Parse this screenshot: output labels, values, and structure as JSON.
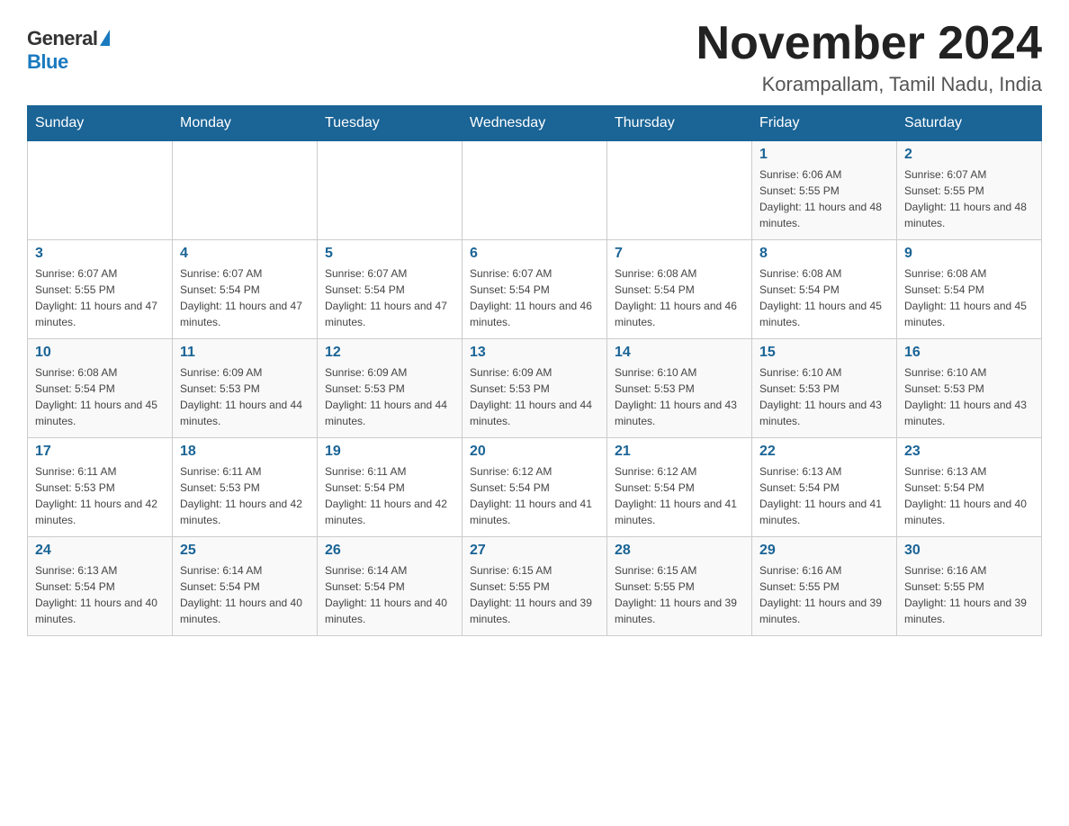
{
  "logo": {
    "general": "General",
    "blue": "Blue"
  },
  "title": "November 2024",
  "location": "Korampallam, Tamil Nadu, India",
  "days_of_week": [
    "Sunday",
    "Monday",
    "Tuesday",
    "Wednesday",
    "Thursday",
    "Friday",
    "Saturday"
  ],
  "weeks": [
    [
      {
        "day": "",
        "sunrise": "",
        "sunset": "",
        "daylight": ""
      },
      {
        "day": "",
        "sunrise": "",
        "sunset": "",
        "daylight": ""
      },
      {
        "day": "",
        "sunrise": "",
        "sunset": "",
        "daylight": ""
      },
      {
        "day": "",
        "sunrise": "",
        "sunset": "",
        "daylight": ""
      },
      {
        "day": "",
        "sunrise": "",
        "sunset": "",
        "daylight": ""
      },
      {
        "day": "1",
        "sunrise": "Sunrise: 6:06 AM",
        "sunset": "Sunset: 5:55 PM",
        "daylight": "Daylight: 11 hours and 48 minutes."
      },
      {
        "day": "2",
        "sunrise": "Sunrise: 6:07 AM",
        "sunset": "Sunset: 5:55 PM",
        "daylight": "Daylight: 11 hours and 48 minutes."
      }
    ],
    [
      {
        "day": "3",
        "sunrise": "Sunrise: 6:07 AM",
        "sunset": "Sunset: 5:55 PM",
        "daylight": "Daylight: 11 hours and 47 minutes."
      },
      {
        "day": "4",
        "sunrise": "Sunrise: 6:07 AM",
        "sunset": "Sunset: 5:54 PM",
        "daylight": "Daylight: 11 hours and 47 minutes."
      },
      {
        "day": "5",
        "sunrise": "Sunrise: 6:07 AM",
        "sunset": "Sunset: 5:54 PM",
        "daylight": "Daylight: 11 hours and 47 minutes."
      },
      {
        "day": "6",
        "sunrise": "Sunrise: 6:07 AM",
        "sunset": "Sunset: 5:54 PM",
        "daylight": "Daylight: 11 hours and 46 minutes."
      },
      {
        "day": "7",
        "sunrise": "Sunrise: 6:08 AM",
        "sunset": "Sunset: 5:54 PM",
        "daylight": "Daylight: 11 hours and 46 minutes."
      },
      {
        "day": "8",
        "sunrise": "Sunrise: 6:08 AM",
        "sunset": "Sunset: 5:54 PM",
        "daylight": "Daylight: 11 hours and 45 minutes."
      },
      {
        "day": "9",
        "sunrise": "Sunrise: 6:08 AM",
        "sunset": "Sunset: 5:54 PM",
        "daylight": "Daylight: 11 hours and 45 minutes."
      }
    ],
    [
      {
        "day": "10",
        "sunrise": "Sunrise: 6:08 AM",
        "sunset": "Sunset: 5:54 PM",
        "daylight": "Daylight: 11 hours and 45 minutes."
      },
      {
        "day": "11",
        "sunrise": "Sunrise: 6:09 AM",
        "sunset": "Sunset: 5:53 PM",
        "daylight": "Daylight: 11 hours and 44 minutes."
      },
      {
        "day": "12",
        "sunrise": "Sunrise: 6:09 AM",
        "sunset": "Sunset: 5:53 PM",
        "daylight": "Daylight: 11 hours and 44 minutes."
      },
      {
        "day": "13",
        "sunrise": "Sunrise: 6:09 AM",
        "sunset": "Sunset: 5:53 PM",
        "daylight": "Daylight: 11 hours and 44 minutes."
      },
      {
        "day": "14",
        "sunrise": "Sunrise: 6:10 AM",
        "sunset": "Sunset: 5:53 PM",
        "daylight": "Daylight: 11 hours and 43 minutes."
      },
      {
        "day": "15",
        "sunrise": "Sunrise: 6:10 AM",
        "sunset": "Sunset: 5:53 PM",
        "daylight": "Daylight: 11 hours and 43 minutes."
      },
      {
        "day": "16",
        "sunrise": "Sunrise: 6:10 AM",
        "sunset": "Sunset: 5:53 PM",
        "daylight": "Daylight: 11 hours and 43 minutes."
      }
    ],
    [
      {
        "day": "17",
        "sunrise": "Sunrise: 6:11 AM",
        "sunset": "Sunset: 5:53 PM",
        "daylight": "Daylight: 11 hours and 42 minutes."
      },
      {
        "day": "18",
        "sunrise": "Sunrise: 6:11 AM",
        "sunset": "Sunset: 5:53 PM",
        "daylight": "Daylight: 11 hours and 42 minutes."
      },
      {
        "day": "19",
        "sunrise": "Sunrise: 6:11 AM",
        "sunset": "Sunset: 5:54 PM",
        "daylight": "Daylight: 11 hours and 42 minutes."
      },
      {
        "day": "20",
        "sunrise": "Sunrise: 6:12 AM",
        "sunset": "Sunset: 5:54 PM",
        "daylight": "Daylight: 11 hours and 41 minutes."
      },
      {
        "day": "21",
        "sunrise": "Sunrise: 6:12 AM",
        "sunset": "Sunset: 5:54 PM",
        "daylight": "Daylight: 11 hours and 41 minutes."
      },
      {
        "day": "22",
        "sunrise": "Sunrise: 6:13 AM",
        "sunset": "Sunset: 5:54 PM",
        "daylight": "Daylight: 11 hours and 41 minutes."
      },
      {
        "day": "23",
        "sunrise": "Sunrise: 6:13 AM",
        "sunset": "Sunset: 5:54 PM",
        "daylight": "Daylight: 11 hours and 40 minutes."
      }
    ],
    [
      {
        "day": "24",
        "sunrise": "Sunrise: 6:13 AM",
        "sunset": "Sunset: 5:54 PM",
        "daylight": "Daylight: 11 hours and 40 minutes."
      },
      {
        "day": "25",
        "sunrise": "Sunrise: 6:14 AM",
        "sunset": "Sunset: 5:54 PM",
        "daylight": "Daylight: 11 hours and 40 minutes."
      },
      {
        "day": "26",
        "sunrise": "Sunrise: 6:14 AM",
        "sunset": "Sunset: 5:54 PM",
        "daylight": "Daylight: 11 hours and 40 minutes."
      },
      {
        "day": "27",
        "sunrise": "Sunrise: 6:15 AM",
        "sunset": "Sunset: 5:55 PM",
        "daylight": "Daylight: 11 hours and 39 minutes."
      },
      {
        "day": "28",
        "sunrise": "Sunrise: 6:15 AM",
        "sunset": "Sunset: 5:55 PM",
        "daylight": "Daylight: 11 hours and 39 minutes."
      },
      {
        "day": "29",
        "sunrise": "Sunrise: 6:16 AM",
        "sunset": "Sunset: 5:55 PM",
        "daylight": "Daylight: 11 hours and 39 minutes."
      },
      {
        "day": "30",
        "sunrise": "Sunrise: 6:16 AM",
        "sunset": "Sunset: 5:55 PM",
        "daylight": "Daylight: 11 hours and 39 minutes."
      }
    ]
  ]
}
